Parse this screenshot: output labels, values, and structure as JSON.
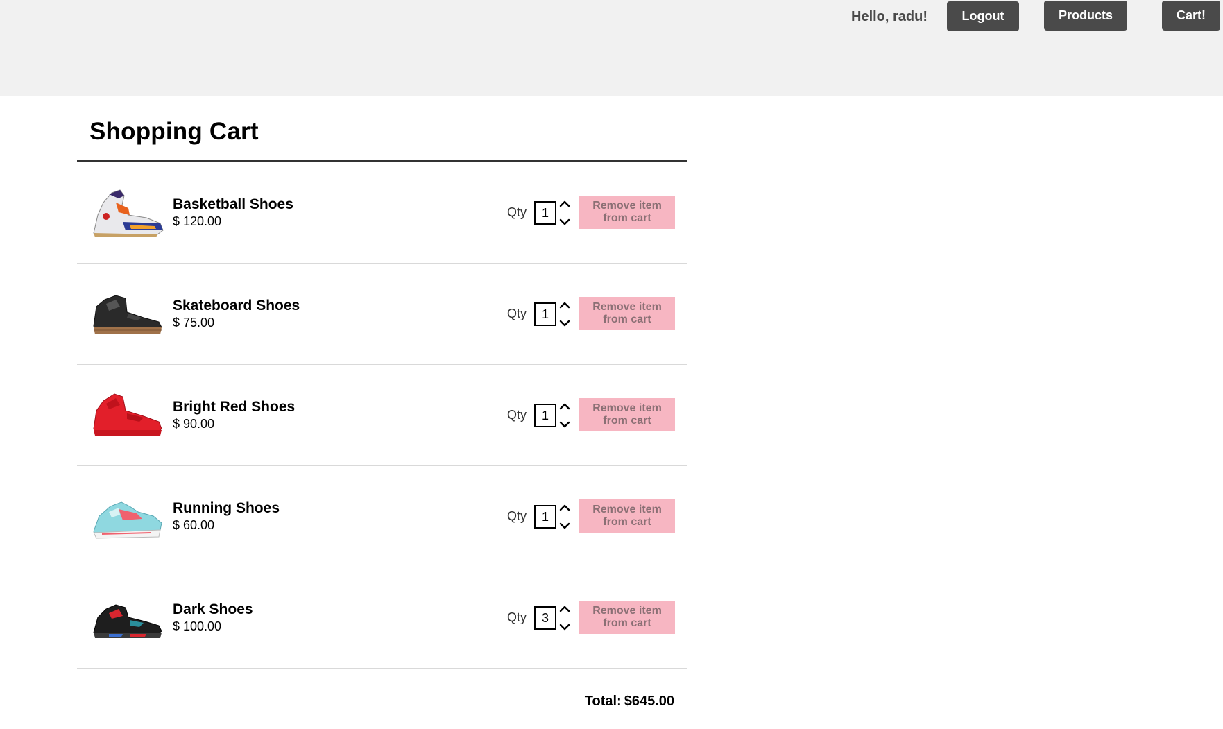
{
  "header": {
    "greeting": "Hello, radu!",
    "logout_label": "Logout",
    "products_label": "Products",
    "cart_label": "Cart!"
  },
  "cart": {
    "title": "Shopping Cart",
    "qty_label": "Qty",
    "remove_label": "Remove item from cart",
    "items": [
      {
        "name": "Basketball Shoes",
        "price": "$ 120.00",
        "qty": "1",
        "image": "basketball-shoe-image"
      },
      {
        "name": "Skateboard Shoes",
        "price": "$ 75.00",
        "qty": "1",
        "image": "skateboard-shoe-image"
      },
      {
        "name": "Bright Red Shoes",
        "price": "$ 90.00",
        "qty": "1",
        "image": "red-shoe-image"
      },
      {
        "name": "Running Shoes",
        "price": "$ 60.00",
        "qty": "1",
        "image": "running-shoe-image"
      },
      {
        "name": "Dark Shoes",
        "price": "$ 100.00",
        "qty": "3",
        "image": "dark-shoe-image"
      }
    ],
    "total_label": "Total:",
    "total_value": "$645.00"
  },
  "colors": {
    "header_bg": "#f1f1f1",
    "nav_button_bg": "#4a4a4a",
    "remove_button_bg": "#f7b6c2",
    "remove_button_text": "#8a6f74"
  }
}
